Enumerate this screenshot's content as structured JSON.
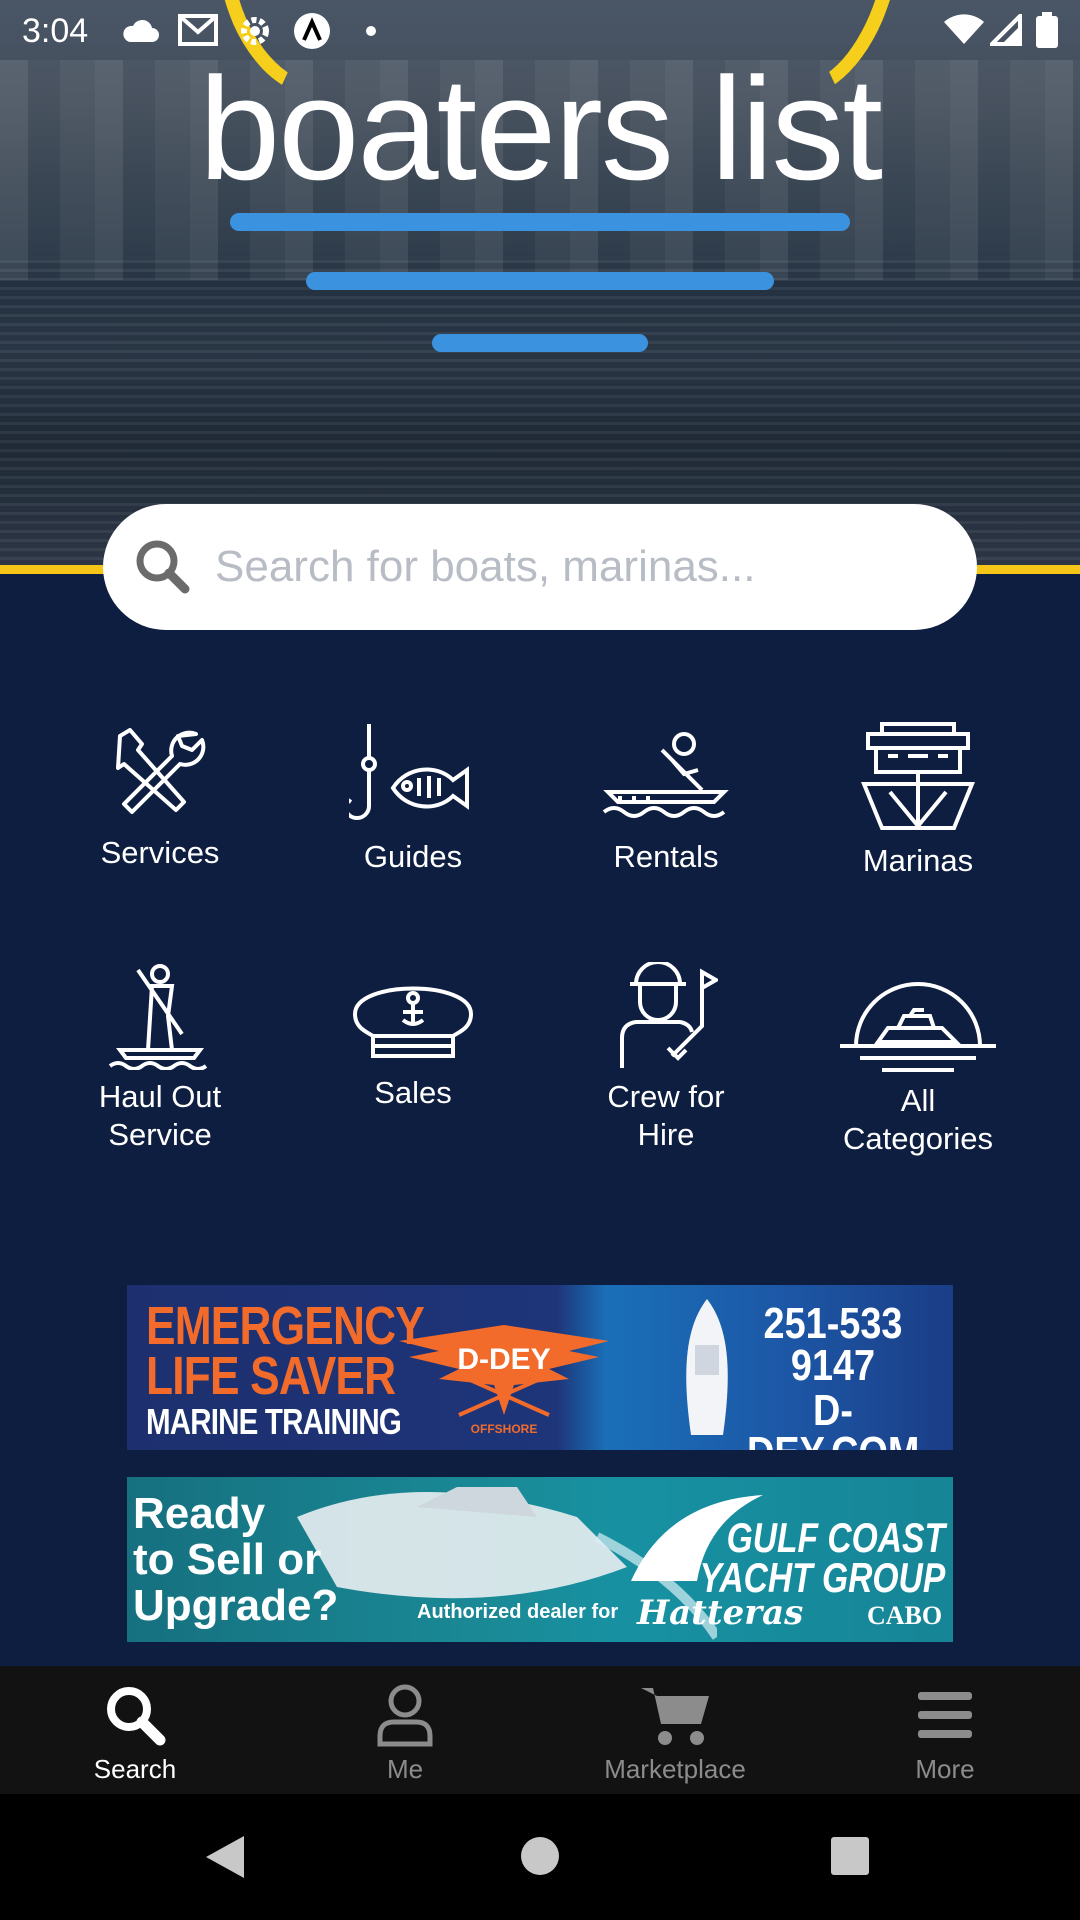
{
  "status_bar": {
    "time": "3:04"
  },
  "logo": {
    "text": "boaters list"
  },
  "search": {
    "placeholder": "Search for boats, marinas..."
  },
  "categories": [
    {
      "label": "Services",
      "icon": "tools-icon"
    },
    {
      "label": "Guides",
      "icon": "fishing-hook-icon"
    },
    {
      "label": "Rentals",
      "icon": "kayak-icon"
    },
    {
      "label": "Marinas",
      "icon": "ship-icon"
    },
    {
      "label": "Haul Out Service",
      "line1": "Haul Out",
      "line2": "Service",
      "icon": "paddleboard-icon"
    },
    {
      "label": "Sales",
      "icon": "captain-hat-icon"
    },
    {
      "label": "Crew for Hire",
      "line1": "Crew for",
      "line2": "Hire",
      "icon": "crew-icon"
    },
    {
      "label": "All Categories",
      "line1": "All",
      "line2": "Categories",
      "icon": "sunset-boat-icon"
    }
  ],
  "ads": {
    "ad1": {
      "line1": "EMERGENCY",
      "line2": "LIFE SAVER",
      "line3": "MARINE TRAINING",
      "brand": "D-DEY",
      "brand_sub": "OFFSHORE",
      "phone1": "251-533",
      "phone2": "9147",
      "site": "D-DEY.COM"
    },
    "ad2": {
      "line1": "Ready",
      "line2": "to Sell or",
      "line3": "Upgrade?",
      "brand1": "GULF COAST",
      "brand2": "YACHT GROUP",
      "dealer": "Authorized dealer for",
      "hatteras": "Hatteras",
      "cabo": "CABO"
    }
  },
  "bottom_nav": [
    {
      "label": "Search",
      "icon": "search-icon",
      "active": true
    },
    {
      "label": "Me",
      "icon": "person-icon",
      "active": false
    },
    {
      "label": "Marketplace",
      "icon": "cart-icon",
      "active": false
    },
    {
      "label": "More",
      "icon": "menu-icon",
      "active": false
    }
  ],
  "colors": {
    "navy": "#0e1e40",
    "accent_blue": "#3b93e0",
    "accent_yellow": "#f5c518",
    "ad_orange": "#f26b2a"
  }
}
